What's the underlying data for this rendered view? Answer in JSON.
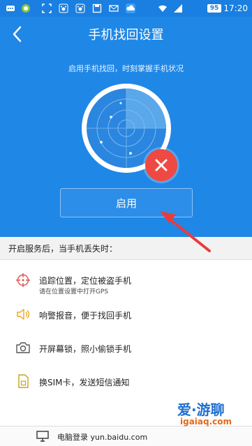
{
  "status_bar": {
    "time": "17:20",
    "battery": "95",
    "icons": [
      "notification-icon",
      "app-icon",
      "scan-icon",
      "paw-icon",
      "paw-icon",
      "save-icon",
      "mail-icon",
      "cloud-icon",
      "wifi-icon",
      "signal-icon",
      "battery-icon"
    ]
  },
  "header": {
    "title": "手机找回设置",
    "subtitle": "启用手机找回，时刻掌握手机状况"
  },
  "hero": {
    "enable_button": "启用",
    "badge_icon": "close-icon"
  },
  "section": {
    "heading": "开启服务后，当手机丢失时："
  },
  "features": [
    {
      "icon": "crosshair-icon",
      "label": "追踪位置，定位被盗手机",
      "note": "请在位置设置中打开GPS"
    },
    {
      "icon": "speaker-icon",
      "label": "响警报音，便于找回手机",
      "note": ""
    },
    {
      "icon": "camera-icon",
      "label": "开屏幕锁，照小偷锁手机",
      "note": ""
    },
    {
      "icon": "sim-icon",
      "label": "换SIM卡，发送短信通知",
      "note": ""
    }
  ],
  "bottom_bar": {
    "text": "电脑登录 yun.baidu.com",
    "icon": "computer-icon"
  },
  "watermark": {
    "line1": "爱·游聊",
    "line2": "igaiaq.com"
  },
  "colors": {
    "primary": "#1f87e6",
    "status_bar": "#1a7fe0",
    "danger": "#ee4a43",
    "arrow": "#e83c3c"
  }
}
